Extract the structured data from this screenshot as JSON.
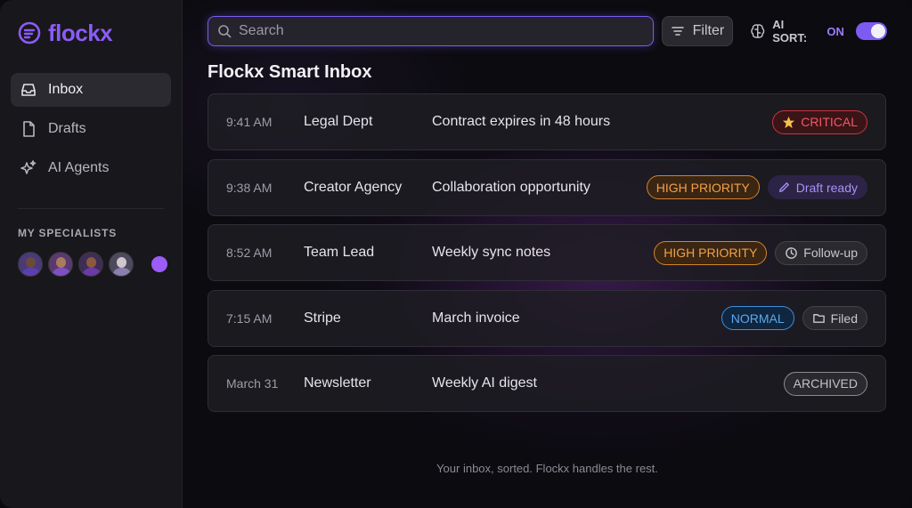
{
  "brand": {
    "name": "flockx",
    "color": "#8b5cf6"
  },
  "sidebar": {
    "items": [
      {
        "label": "Inbox",
        "icon": "inbox-icon",
        "active": true
      },
      {
        "label": "Drafts",
        "icon": "document-icon",
        "active": false
      },
      {
        "label": "AI Agents",
        "icon": "sparkle-icon",
        "active": false
      }
    ],
    "specialists_title": "MY SPECIALISTS"
  },
  "search": {
    "placeholder": "Search",
    "value": ""
  },
  "toolbar": {
    "filter_label": "Filter",
    "ai_sort_label": "AI SORT:",
    "ai_sort_state": "ON"
  },
  "inbox": {
    "title": "Flockx Smart Inbox"
  },
  "messages": [
    {
      "time": "9:41 AM",
      "sender": "Legal Dept",
      "subject": "Contract expires in 48 hours",
      "badges": [
        {
          "label": "CRITICAL",
          "kind": "critical",
          "icon": "star-icon"
        }
      ]
    },
    {
      "time": "9:38 AM",
      "sender": "Creator Agency",
      "subject": "Collaboration opportunity",
      "badges": [
        {
          "label": "HIGH PRIORITY",
          "kind": "high"
        },
        {
          "label": "Draft ready",
          "kind": "draft",
          "icon": "pencil-icon"
        }
      ]
    },
    {
      "time": "8:52 AM",
      "sender": "Team Lead",
      "subject": "Weekly sync notes",
      "badges": [
        {
          "label": "HIGH PRIORITY",
          "kind": "high"
        },
        {
          "label": "Follow-up",
          "kind": "neutral",
          "icon": "clock-icon"
        }
      ]
    },
    {
      "time": "7:15 AM",
      "sender": "Stripe",
      "subject": "March invoice",
      "badges": [
        {
          "label": "NORMAL",
          "kind": "normal"
        },
        {
          "label": "Filed",
          "kind": "neutral",
          "icon": "folder-icon"
        }
      ]
    },
    {
      "time": "March 31",
      "sender": "Newsletter",
      "subject": "Weekly AI digest",
      "badges": [
        {
          "label": "ARCHIVED",
          "kind": "archived"
        }
      ]
    }
  ],
  "footer": {
    "text": "Your inbox, sorted. Flockx handles the rest."
  }
}
